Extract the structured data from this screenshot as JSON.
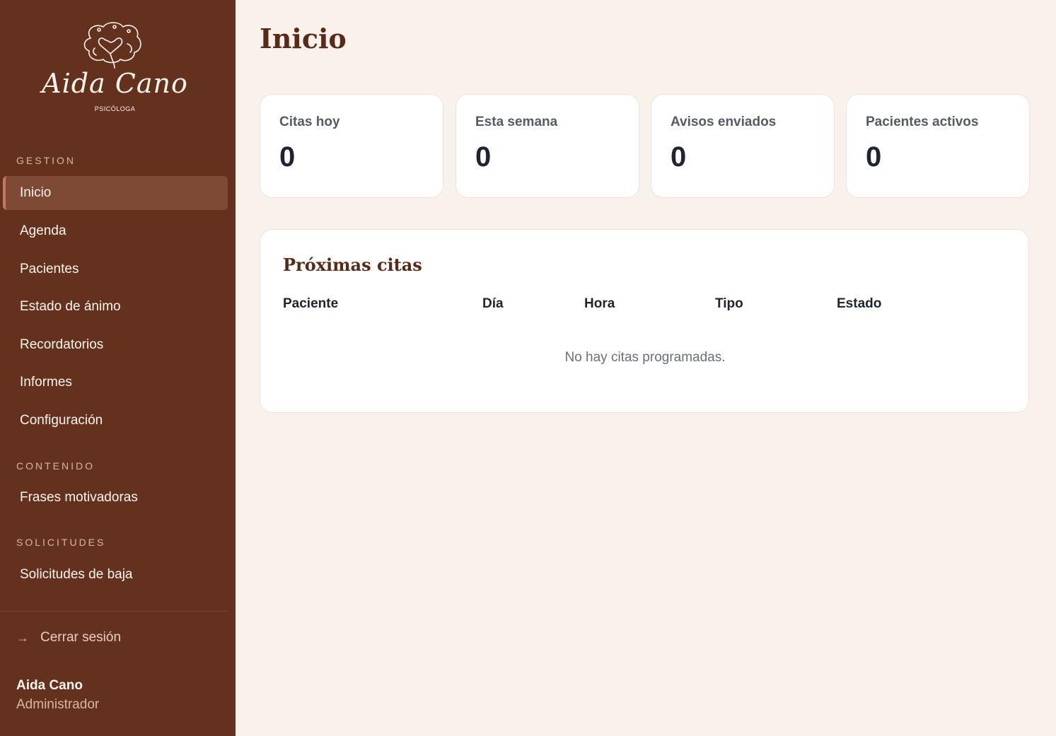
{
  "brand": {
    "name": "Aida Cano",
    "subtitle": "PSICÓLOGA"
  },
  "sidebar": {
    "sections": [
      {
        "title": "GESTION",
        "items": [
          "Inicio",
          "Agenda",
          "Pacientes",
          "Estado de ánimo",
          "Recordatorios",
          "Informes",
          "Configuración"
        ]
      },
      {
        "title": "CONTENIDO",
        "items": [
          "Frases motivadoras"
        ]
      },
      {
        "title": "SOLICITUDES",
        "items": [
          "Solicitudes de baja"
        ]
      }
    ],
    "active_item": "Inicio",
    "logout_arrow": "→",
    "logout_label": "Cerrar sesión",
    "user": {
      "name": "Aida Cano",
      "role": "Administrador"
    }
  },
  "main": {
    "title": "Inicio",
    "stats": [
      {
        "label": "Citas hoy",
        "value": "0"
      },
      {
        "label": "Esta semana",
        "value": "0"
      },
      {
        "label": "Avisos enviados",
        "value": "0"
      },
      {
        "label": "Pacientes activos",
        "value": "0"
      }
    ],
    "upcoming": {
      "title": "Próximas citas",
      "columns": [
        "Paciente",
        "Día",
        "Hora",
        "Tipo",
        "Estado"
      ],
      "empty_message": "No hay citas programadas."
    }
  },
  "colors": {
    "sidebar_bg": "#63311d",
    "active_item_bg": "#7e4a36",
    "accent": "#c07a5d",
    "page_bg": "#f8f1ec",
    "title_color": "#5a2a18"
  }
}
